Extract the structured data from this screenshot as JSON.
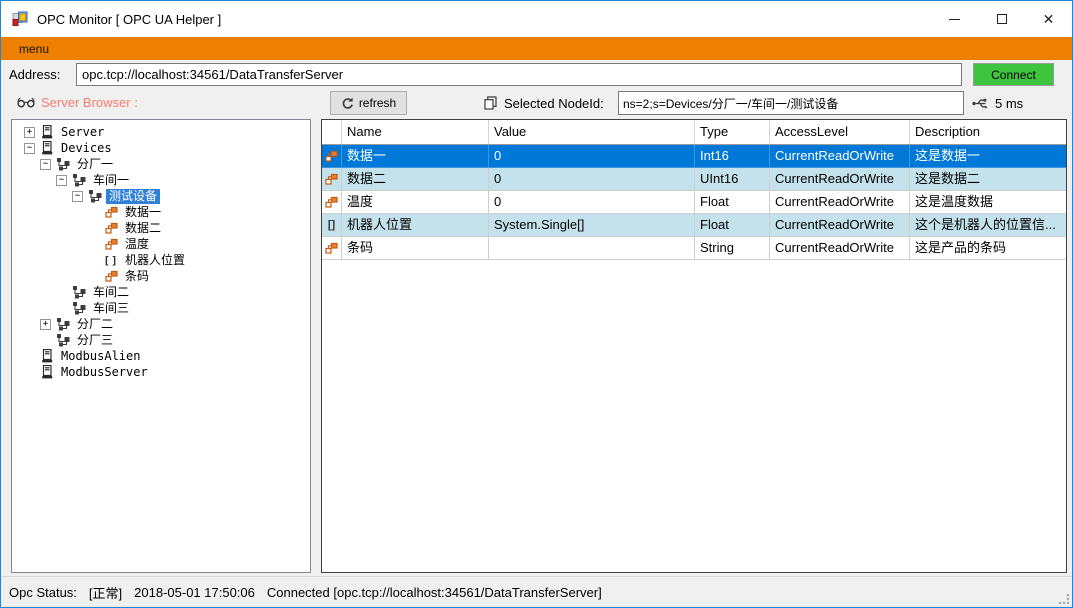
{
  "window": {
    "title": "OPC Monitor [ OPC UA Helper ]"
  },
  "menu": {
    "label": "menu"
  },
  "address": {
    "label": "Address:",
    "value": "opc.tcp://localhost:34561/DataTransferServer",
    "connect_label": "Connect"
  },
  "toolbar": {
    "browser_label": "Server Browser :",
    "refresh_label": "refresh",
    "nodeid_label": "Selected NodeId:",
    "nodeid_value": "ns=2;s=Devices/分厂一/车间一/测试设备",
    "ping_label": "5 ms"
  },
  "tree": {
    "items": [
      {
        "label": "Server",
        "level": 0,
        "expander": "plus",
        "icon": "server",
        "selected": false
      },
      {
        "label": "Devices",
        "level": 0,
        "expander": "minus",
        "icon": "server",
        "selected": false
      },
      {
        "label": "分厂一",
        "level": 1,
        "expander": "minus",
        "icon": "sitemap",
        "selected": false
      },
      {
        "label": "车间一",
        "level": 2,
        "expander": "minus",
        "icon": "sitemap",
        "selected": false
      },
      {
        "label": "测试设备",
        "level": 3,
        "expander": "minus",
        "icon": "sitemap",
        "selected": true
      },
      {
        "label": "数据一",
        "level": 4,
        "expander": null,
        "icon": "tag",
        "selected": false
      },
      {
        "label": "数据二",
        "level": 4,
        "expander": null,
        "icon": "tag",
        "selected": false
      },
      {
        "label": "温度",
        "level": 4,
        "expander": null,
        "icon": "tag",
        "selected": false
      },
      {
        "label": "机器人位置",
        "level": 4,
        "expander": null,
        "icon": "array",
        "selected": false
      },
      {
        "label": "条码",
        "level": 4,
        "expander": null,
        "icon": "tag",
        "selected": false
      },
      {
        "label": "车间二",
        "level": 2,
        "expander": null,
        "icon": "sitemap",
        "selected": false
      },
      {
        "label": "车间三",
        "level": 2,
        "expander": null,
        "icon": "sitemap",
        "selected": false
      },
      {
        "label": "分厂二",
        "level": 1,
        "expander": "plus",
        "icon": "sitemap",
        "selected": false
      },
      {
        "label": "分厂三",
        "level": 1,
        "expander": null,
        "icon": "sitemap",
        "selected": false
      },
      {
        "label": "ModbusAlien",
        "level": 0,
        "expander": null,
        "icon": "server",
        "selected": false
      },
      {
        "label": "ModbusServer",
        "level": 0,
        "expander": null,
        "icon": "server",
        "selected": false
      }
    ]
  },
  "table": {
    "headers": [
      "Name",
      "Value",
      "Type",
      "AccessLevel",
      "Description"
    ],
    "rows": [
      {
        "icon": "tag",
        "name": "数据一",
        "value": "0",
        "type": "Int16",
        "access": "CurrentReadOrWrite",
        "desc": "这是数据一",
        "selected": true,
        "alt": false
      },
      {
        "icon": "tag",
        "name": "数据二",
        "value": "0",
        "type": "UInt16",
        "access": "CurrentReadOrWrite",
        "desc": "这是数据二",
        "selected": false,
        "alt": true
      },
      {
        "icon": "tag",
        "name": "温度",
        "value": "0",
        "type": "Float",
        "access": "CurrentReadOrWrite",
        "desc": "这是温度数据",
        "selected": false,
        "alt": false
      },
      {
        "icon": "array",
        "name": "机器人位置",
        "value": "System.Single[]",
        "type": "Float",
        "access": "CurrentReadOrWrite",
        "desc": "这个是机器人的位置信...",
        "selected": false,
        "alt": true
      },
      {
        "icon": "tag",
        "name": "条码",
        "value": "",
        "type": "String",
        "access": "CurrentReadOrWrite",
        "desc": "这是产品的条码",
        "selected": false,
        "alt": false
      }
    ]
  },
  "status": {
    "label": "Opc Status:",
    "state": "[正常]",
    "timestamp": "2018-05-01 17:50:06",
    "connection": "Connected [opc.tcp://localhost:34561/DataTransferServer]"
  },
  "colors": {
    "accent_orange": "#EE7F00",
    "connect_green": "#3EC43E",
    "selection_blue": "#0078D7",
    "tree_selection_blue": "#3080D8",
    "alt_row_blue": "#C4E2EC",
    "browser_label_coral": "#F87B6B",
    "window_border_blue": "#2383D5"
  }
}
